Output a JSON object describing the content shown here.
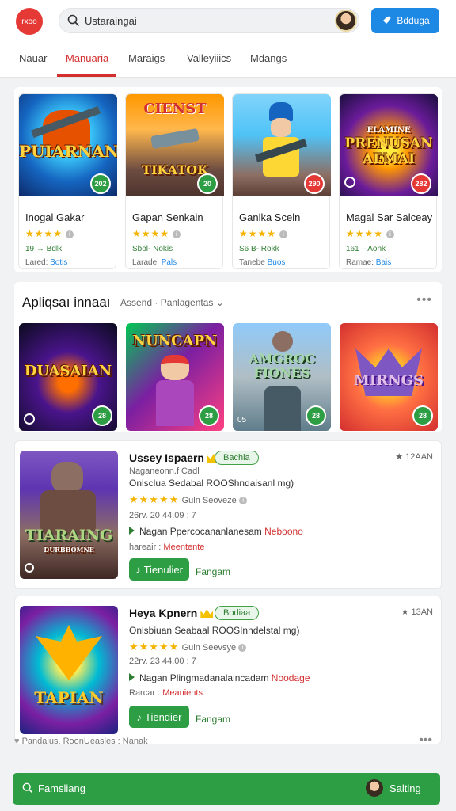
{
  "header": {
    "logo_text": "rxoo",
    "search_text": "Ustaraingai",
    "button_label": "Bdduga"
  },
  "tabs": [
    "Nauar",
    "Manuaria",
    "Maraigs",
    "Valleyiiics",
    "Mdangs"
  ],
  "featured": [
    {
      "art": "PUIARNAN",
      "badge": "202",
      "title": "Inogal Gakar",
      "stars": "★★★★",
      "meta": "19 → Bdlk",
      "meta2_prefix": "Lared:",
      "meta2_link": "Botis"
    },
    {
      "art": "TIKATOK",
      "art_top": "CIENST",
      "badge": "20",
      "title": "Gapan Senkain",
      "stars": "★★★★",
      "meta": "Sbol- Nokis",
      "meta2_prefix": "Larade:",
      "meta2_link": "Pals"
    },
    {
      "art": "",
      "badge": "290",
      "title": "Ganlka Sceln",
      "stars": "★★★★",
      "meta": "S6 B- Rokk",
      "meta2_prefix": "Tanebe",
      "meta2_link": "Buos"
    },
    {
      "art": "PRENUSAN AEMAI",
      "art_top": "ELAMINE",
      "badge": "282",
      "title": "Magal Sar Salceay",
      "stars": "★★★★",
      "meta": "161 – Aonk",
      "meta2_prefix": "Ramae:",
      "meta2_link": "Bais"
    }
  ],
  "section2": {
    "title": "Apliqsaı innaaı",
    "subtitle": "Assend · Panlagentas",
    "tiles": [
      {
        "art": "DUASAIAN",
        "badge": "28"
      },
      {
        "art": "NUNCAPN",
        "badge": "28"
      },
      {
        "art": "AMGROC FIONES",
        "badge": "28"
      },
      {
        "art": "MIRNGS",
        "badge": "28"
      }
    ]
  },
  "apps": [
    {
      "name": "Ussey Ispaern",
      "pill": "Bachia",
      "rank": "★ 12AAN",
      "art": "TIARAING",
      "art_sub": "DURBBOMNE",
      "line1": "Naganeonn.f Cadl",
      "line2": "Onlsclua Sedabal ROOShndaisanl mg)",
      "stars": "★★★★★",
      "rating_text": "Guln Seoveze",
      "line4": "26rv. 20 44.09 : 7",
      "line5_prefix": "Nagan Ppercocananlanesam",
      "line5_red": "Neboono",
      "line6_prefix": "hareair :",
      "line6_red": "Meentente",
      "install": "Tienulier",
      "install_link": "Fangam"
    },
    {
      "name": "Heya Kpnern",
      "pill": "Bodiaa",
      "rank": "★ 13AN",
      "art": "TAPIAN",
      "line1": "",
      "line2": "Onlsbiuan Seabaal ROOSInndelstal mg)",
      "stars": "★★★★★",
      "rating_text": "Guln Seevsye",
      "line4": "22rv. 23 44.00 : 7",
      "line5_prefix": "Nagan Plingmadanalaincadam",
      "line5_red": "Noodage",
      "line6_prefix": "Rarcar :",
      "line6_red": "Meanients",
      "install": "Tiendier",
      "install_link": "Fangam"
    }
  ],
  "footer": {
    "line": "Pandalus. RoonUeasles : Nanak",
    "search_label": "Famsliang",
    "right_label": "Salting"
  },
  "colors": {
    "accent_red": "#d32f2f",
    "accent_green": "#2e9e44",
    "accent_blue": "#1e88e5",
    "star": "#f5b300"
  }
}
